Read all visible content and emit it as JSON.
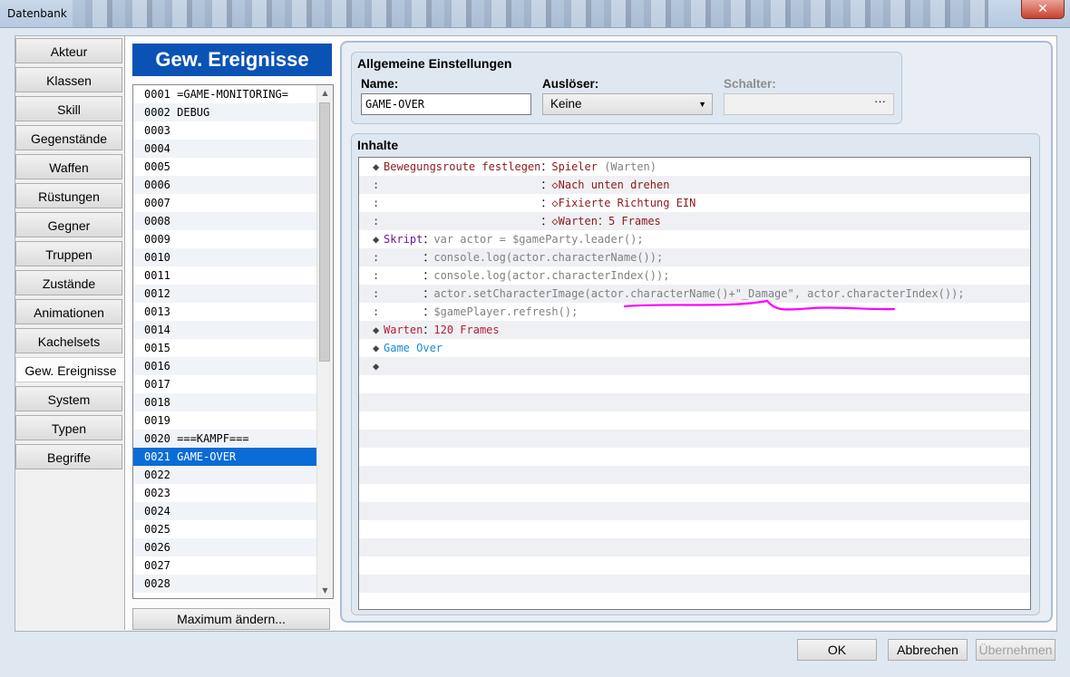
{
  "window": {
    "title": "Datenbank",
    "close_glyph": "✕"
  },
  "tabs": [
    "Akteur",
    "Klassen",
    "Skill",
    "Gegenstände",
    "Waffen",
    "Rüstungen",
    "Gegner",
    "Truppen",
    "Zustände",
    "Animationen",
    "Kachelsets",
    "Gew. Ereignisse",
    "System",
    "Typen",
    "Begriffe"
  ],
  "active_tab": "Gew. Ereignisse",
  "list": {
    "header": "Gew. Ereignisse",
    "selected": "0021 GAME-OVER",
    "items": [
      "0001 =GAME-MONITORING=",
      "0002 DEBUG",
      "0003",
      "0004",
      "0005",
      "0006",
      "0007",
      "0008",
      "0009",
      "0010",
      "0011",
      "0012",
      "0013",
      "0014",
      "0015",
      "0016",
      "0017",
      "0018",
      "0019",
      "0020 ===KAMPF===",
      "0021 GAME-OVER",
      "0022",
      "0023",
      "0024",
      "0025",
      "0026",
      "0027",
      "0028"
    ],
    "max_button": "Maximum ändern..."
  },
  "general": {
    "title": "Allgemeine Einstellungen",
    "name_label": "Name:",
    "name_value": "GAME-OVER",
    "trigger_label": "Auslöser:",
    "trigger_value": "Keine",
    "switch_label": "Schalter:",
    "switch_value": "",
    "switch_dots": "···"
  },
  "contents": {
    "title": "Inhalte",
    "lines": [
      {
        "gutter": "◆",
        "parts": [
          {
            "t": "Bewegungsroute festlegen",
            "c": "c-red"
          },
          {
            "t": "：",
            "c": "c-black"
          },
          {
            "t": "Spieler",
            "c": "c-red"
          },
          {
            "t": " (Warten)",
            "c": "c-gray"
          }
        ]
      },
      {
        "gutter": ":",
        "parts": [
          {
            "t": "                        ：",
            "c": "c-black"
          },
          {
            "t": "◇Nach unten drehen",
            "c": "c-red"
          }
        ]
      },
      {
        "gutter": ":",
        "parts": [
          {
            "t": "                        ：",
            "c": "c-black"
          },
          {
            "t": "◇Fixierte Richtung EIN",
            "c": "c-red"
          }
        ]
      },
      {
        "gutter": ":",
        "parts": [
          {
            "t": "                        ：",
            "c": "c-black"
          },
          {
            "t": "◇Warten：5 Frames",
            "c": "c-red"
          }
        ]
      },
      {
        "gutter": "◆",
        "parts": [
          {
            "t": "Skript",
            "c": "c-purple"
          },
          {
            "t": "：",
            "c": "c-black"
          },
          {
            "t": "var actor = $gameParty.leader();",
            "c": "c-gray"
          }
        ]
      },
      {
        "gutter": ":",
        "parts": [
          {
            "t": "      ：",
            "c": "c-black"
          },
          {
            "t": "console.log(actor.characterName());",
            "c": "c-gray"
          }
        ]
      },
      {
        "gutter": ":",
        "parts": [
          {
            "t": "      ：",
            "c": "c-black"
          },
          {
            "t": "console.log(actor.characterIndex());",
            "c": "c-gray"
          }
        ]
      },
      {
        "gutter": ":",
        "parts": [
          {
            "t": "      ：",
            "c": "c-black"
          },
          {
            "t": "actor.setCharacterImage(actor.characterName()+\"_Damage\", actor.characterIndex());",
            "c": "c-gray"
          }
        ]
      },
      {
        "gutter": ":",
        "parts": [
          {
            "t": "      ：",
            "c": "c-black"
          },
          {
            "t": "$gamePlayer.refresh();",
            "c": "c-gray"
          }
        ]
      },
      {
        "gutter": "◆",
        "parts": [
          {
            "t": "Warten",
            "c": "c-crimson"
          },
          {
            "t": "：",
            "c": "c-black"
          },
          {
            "t": "120 Frames",
            "c": "c-crimson"
          }
        ]
      },
      {
        "gutter": "◆",
        "parts": [
          {
            "t": "Game Over",
            "c": "c-blue"
          }
        ]
      },
      {
        "gutter": "◆",
        "parts": []
      }
    ],
    "empty_rows": 13,
    "annotation_color": "#ff00ff"
  },
  "buttons": {
    "ok": "OK",
    "cancel": "Abbrechen",
    "apply": "Übernehmen"
  }
}
